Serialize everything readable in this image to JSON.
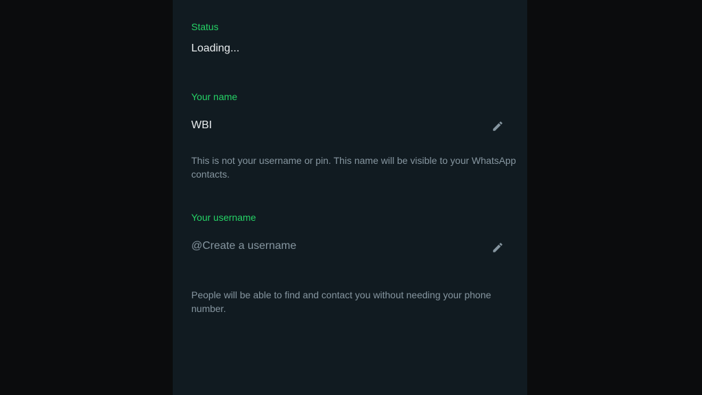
{
  "status": {
    "label": "Status",
    "value": "Loading..."
  },
  "name": {
    "label": "Your name",
    "value": "WBI",
    "edit_icon": "pencil-icon",
    "help": "This is not your username or pin. This name will be visible to your WhatsApp contacts."
  },
  "username": {
    "label": "Your username",
    "prefix": "@",
    "placeholder": "Create a username",
    "edit_icon": "pencil-icon",
    "help": "People will be able to find and contact you without needing your phone number."
  },
  "colors": {
    "accent": "#25d366",
    "panel_bg": "#111b21",
    "text_primary": "#e9edef",
    "text_secondary": "#8696a0"
  }
}
